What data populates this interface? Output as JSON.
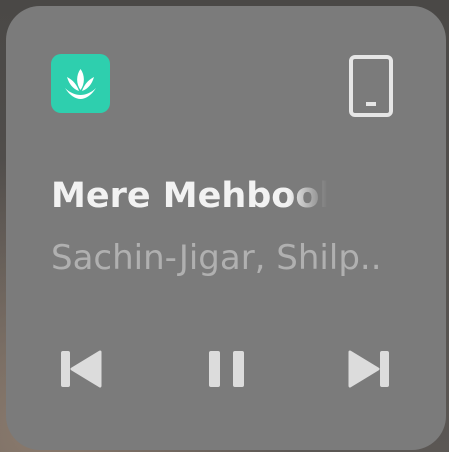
{
  "widget": {
    "app_icon": "jiosaavn-app-icon",
    "device_icon": "phone-device-icon",
    "colors": {
      "app_accent": "#2ecfae",
      "card": "#7b7b7b",
      "title_text": "#f2f2f2",
      "subtitle_text": "#b0b0b0",
      "icons": "#dcdcdc"
    },
    "track_title": "Mere Mehbook",
    "track_artist": "Sachin-Jigar, Shilp..",
    "controls": {
      "previous": "skip-previous-icon",
      "play_pause": "pause-icon",
      "next": "skip-next-icon"
    }
  }
}
